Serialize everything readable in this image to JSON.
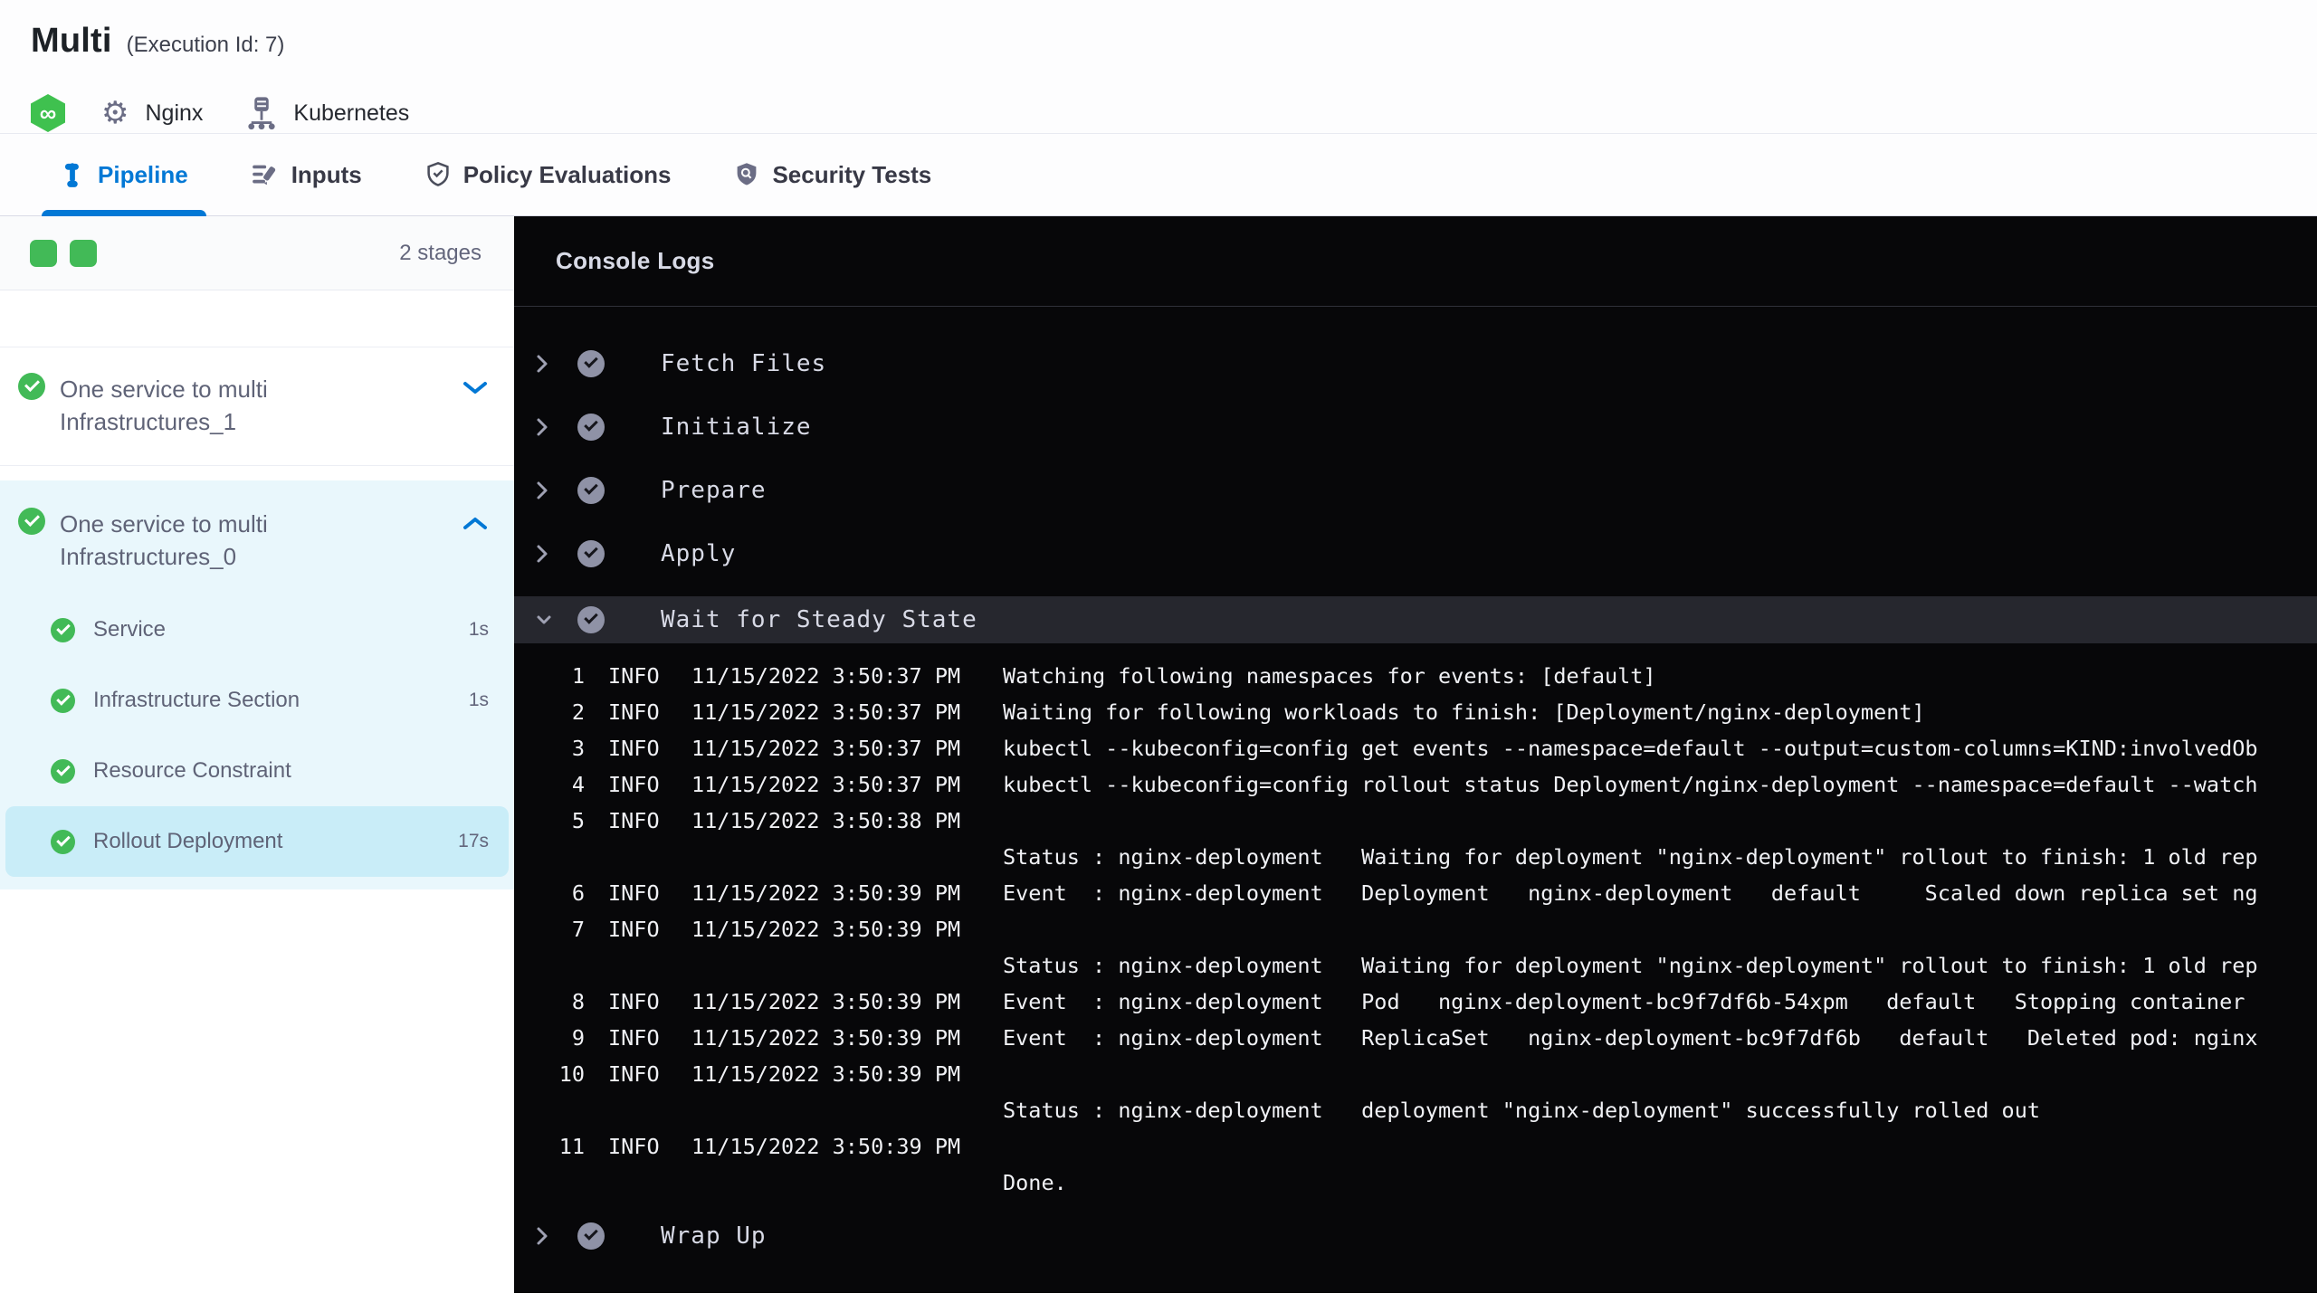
{
  "colors": {
    "accent_blue": "#0278d5",
    "success_green": "#42ba57",
    "console_bg": "#070709",
    "selected_step_bg": "#c9edf8"
  },
  "header": {
    "title": "Multi",
    "execution_id": "(Execution Id: 7)",
    "service_label": "Nginx",
    "infra_label": "Kubernetes"
  },
  "tabs": [
    {
      "label": "Pipeline",
      "active": true
    },
    {
      "label": "Inputs",
      "active": false
    },
    {
      "label": "Policy Evaluations",
      "active": false
    },
    {
      "label": "Security Tests",
      "active": false
    }
  ],
  "sidebar": {
    "stages_count_label": "2 stages",
    "stages": [
      {
        "name": "One service to multi Infrastructures_1",
        "status": "success",
        "expanded": false
      },
      {
        "name": "One service to multi Infrastructures_0",
        "status": "success",
        "expanded": true,
        "steps": [
          {
            "name": "Service",
            "duration": "1s",
            "selected": false
          },
          {
            "name": "Infrastructure Section",
            "duration": "1s",
            "selected": false
          },
          {
            "name": "Resource Constraint",
            "duration": "",
            "selected": false
          },
          {
            "name": "Rollout Deployment",
            "duration": "17s",
            "selected": true
          }
        ]
      }
    ]
  },
  "console": {
    "title": "Console Logs",
    "steps_before": [
      {
        "name": "Fetch Files",
        "status": "success"
      },
      {
        "name": "Initialize",
        "status": "success"
      },
      {
        "name": "Prepare",
        "status": "success"
      },
      {
        "name": "Apply",
        "status": "success"
      }
    ],
    "expanded_step": {
      "name": "Wait for Steady State",
      "status": "success"
    },
    "steps_after": [
      {
        "name": "Wrap Up",
        "status": "success"
      }
    ],
    "logs": [
      {
        "num": "1",
        "level": "INFO",
        "time": "11/15/2022 3:50:37 PM",
        "msg": "Watching following namespaces for events: [default]"
      },
      {
        "num": "2",
        "level": "INFO",
        "time": "11/15/2022 3:50:37 PM",
        "msg": "Waiting for following workloads to finish: [Deployment/nginx-deployment]"
      },
      {
        "num": "3",
        "level": "INFO",
        "time": "11/15/2022 3:50:37 PM",
        "msg": "kubectl --kubeconfig=config get events --namespace=default --output=custom-columns=KIND:involvedOb"
      },
      {
        "num": "4",
        "level": "INFO",
        "time": "11/15/2022 3:50:37 PM",
        "msg": "kubectl --kubeconfig=config rollout status Deployment/nginx-deployment --namespace=default --watch"
      },
      {
        "num": "5",
        "level": "INFO",
        "time": "11/15/2022 3:50:38 PM",
        "msg": ""
      },
      {
        "num": "",
        "level": "",
        "time": "",
        "msg": "Status : nginx-deployment   Waiting for deployment \"nginx-deployment\" rollout to finish: 1 old rep"
      },
      {
        "num": "6",
        "level": "INFO",
        "time": "11/15/2022 3:50:39 PM",
        "msg": "Event  : nginx-deployment   Deployment   nginx-deployment   default     Scaled down replica set ng"
      },
      {
        "num": "7",
        "level": "INFO",
        "time": "11/15/2022 3:50:39 PM",
        "msg": ""
      },
      {
        "num": "",
        "level": "",
        "time": "",
        "msg": "Status : nginx-deployment   Waiting for deployment \"nginx-deployment\" rollout to finish: 1 old rep"
      },
      {
        "num": "8",
        "level": "INFO",
        "time": "11/15/2022 3:50:39 PM",
        "msg": "Event  : nginx-deployment   Pod   nginx-deployment-bc9f7df6b-54xpm   default   Stopping container "
      },
      {
        "num": "9",
        "level": "INFO",
        "time": "11/15/2022 3:50:39 PM",
        "msg": "Event  : nginx-deployment   ReplicaSet   nginx-deployment-bc9f7df6b   default   Deleted pod: nginx"
      },
      {
        "num": "10",
        "level": "INFO",
        "time": "11/15/2022 3:50:39 PM",
        "msg": ""
      },
      {
        "num": "",
        "level": "",
        "time": "",
        "msg": "Status : nginx-deployment   deployment \"nginx-deployment\" successfully rolled out"
      },
      {
        "num": "11",
        "level": "INFO",
        "time": "11/15/2022 3:50:39 PM",
        "msg": ""
      },
      {
        "num": "",
        "level": "",
        "time": "",
        "msg": "Done."
      }
    ]
  }
}
